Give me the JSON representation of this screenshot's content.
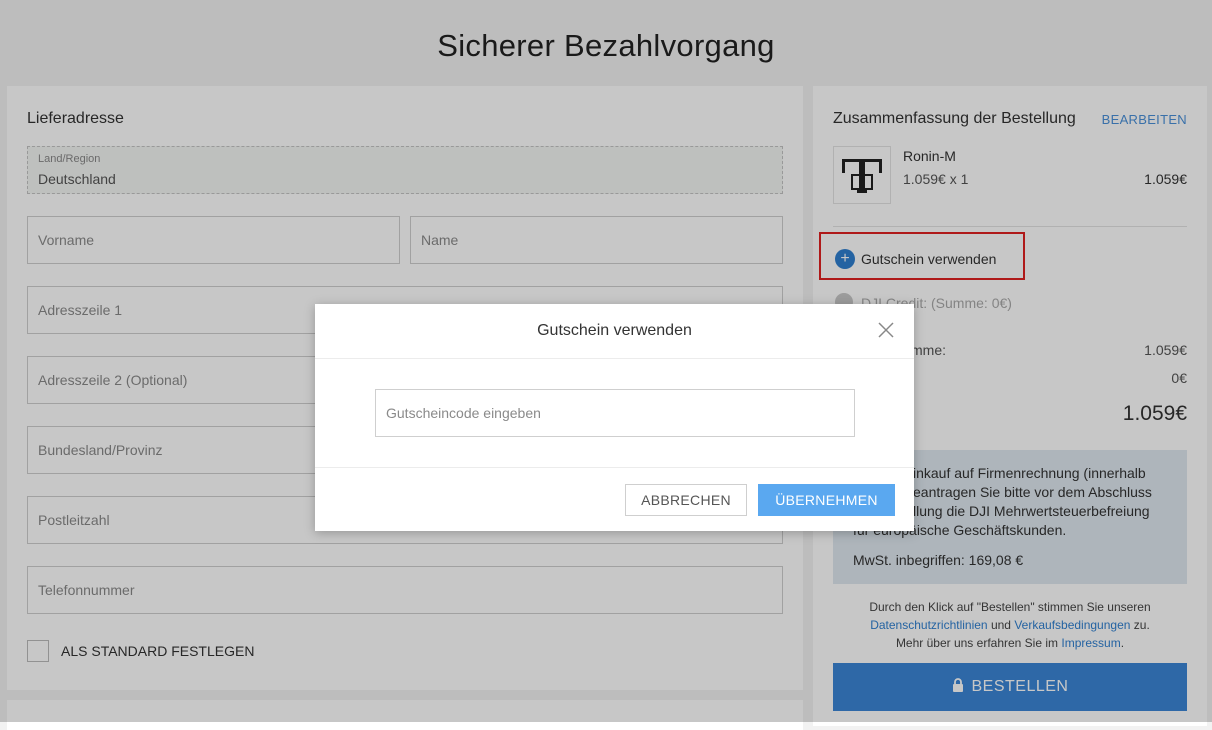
{
  "page": {
    "title": "Sicherer Bezahlvorgang"
  },
  "address": {
    "section_title": "Lieferadresse",
    "country_label": "Land/Region",
    "country_value": "Deutschland",
    "first_name_placeholder": "Vorname",
    "last_name_placeholder": "Name",
    "address1_placeholder": "Adresszeile 1",
    "address2_placeholder": "Adresszeile 2 (Optional)",
    "state_placeholder": "Bundesland/Provinz",
    "zip_placeholder": "Postleitzahl",
    "phone_placeholder": "Telefonnummer",
    "default_label": "ALS STANDARD FESTLEGEN"
  },
  "summary": {
    "title": "Zusammenfassung der Bestellung",
    "edit_label": "BEARBEITEN",
    "product": {
      "name": "Ronin-M",
      "qty_price": "1.059€ x 1",
      "total": "1.059€"
    },
    "coupon_label": "Gutschein verwenden",
    "credit_label": "DJI Credit: (Summe: 0€)",
    "subtotal_label_partial": "mme:",
    "subtotal_value": "1.059€",
    "shipping_value": "0€",
    "grand_total": "1.059€",
    "info_lines": [
      "inkauf auf Firmenrechnung (innerhalb",
      "eantragen Sie bitte vor dem Abschluss",
      "llung die DJI Mehrwertsteuerbefreiung",
      "für europäische Geschäftskunden."
    ],
    "vat_text": "MwSt. inbegriffen: 169,08 €",
    "legal": {
      "line1": "Durch den Klick auf \"Bestellen\" stimmen Sie unseren",
      "privacy_link": "Datenschutzrichtlinien",
      "and": "und",
      "terms_link": "Verkaufsbedingungen",
      "to": "zu.",
      "line3_prefix": "Mehr über uns erfahren Sie im",
      "imprint_link": "Impressum",
      "line3_suffix": "."
    },
    "order_button": "BESTELLEN"
  },
  "modal": {
    "title": "Gutschein verwenden",
    "input_placeholder": "Gutscheincode eingeben",
    "cancel_label": "ABBRECHEN",
    "apply_label": "ÜBERNEHMEN"
  },
  "colors": {
    "accent": "#3b86d6",
    "apply_button": "#5aa8f0",
    "highlight_border": "#e02020",
    "info_box": "#dfe8f0"
  },
  "icons": [
    "plus-icon",
    "lock-icon",
    "close-icon",
    "product-image"
  ]
}
